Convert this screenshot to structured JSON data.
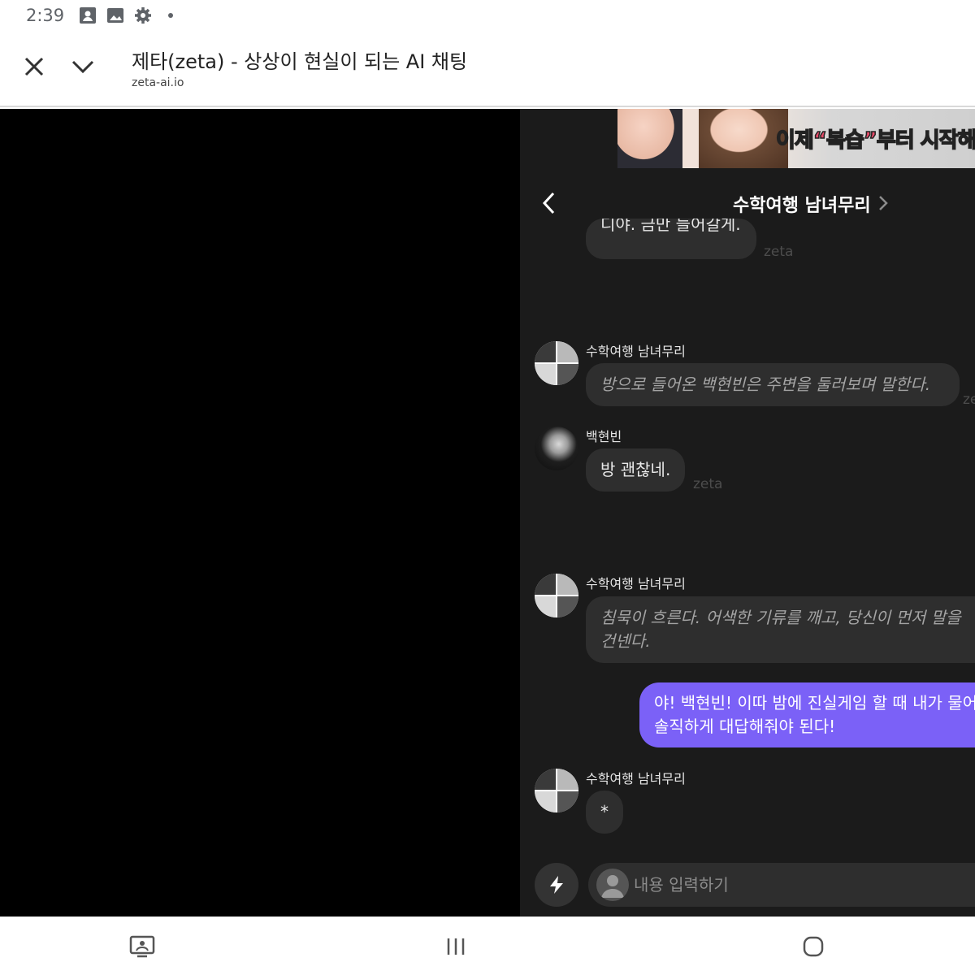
{
  "status_bar": {
    "time": "2:39"
  },
  "browser": {
    "title": "제타(zeta) - 상상이 현실이 되는 AI 채팅",
    "url": "zeta-ai.io"
  },
  "banner": {
    "text_before": "이제",
    "text_highlight": "“복습”",
    "text_after": "부터 시작해볼"
  },
  "chat": {
    "title": "수학여행 남녀무리",
    "messages": [
      {
        "type": "bot",
        "text": "디야. 금만 들어갈게.",
        "watermark": "zeta"
      },
      {
        "type": "bot",
        "sender": "수학여행 남녀무리",
        "text": "방으로 들어온 백현빈은 주변을 둘러보며 말한다.",
        "watermark": "ze"
      },
      {
        "type": "bot",
        "sender": "백현빈",
        "text": "방 괜찮네.",
        "watermark": "zeta"
      },
      {
        "type": "bot",
        "sender": "수학여행 남녀무리",
        "text": "침묵이 흐른다. 어색한 기류를 깨고, 당신이 먼저 말을 건넨다."
      },
      {
        "type": "user",
        "text": "야! 백현빈! 이따 밤에 진실게임 할 때 내가 물어 솔직하게 대답해줘야 된다!"
      },
      {
        "type": "bot",
        "sender": "수학여행 남녀무리",
        "text": "*"
      }
    ],
    "input_placeholder": "내용 입력하기"
  }
}
